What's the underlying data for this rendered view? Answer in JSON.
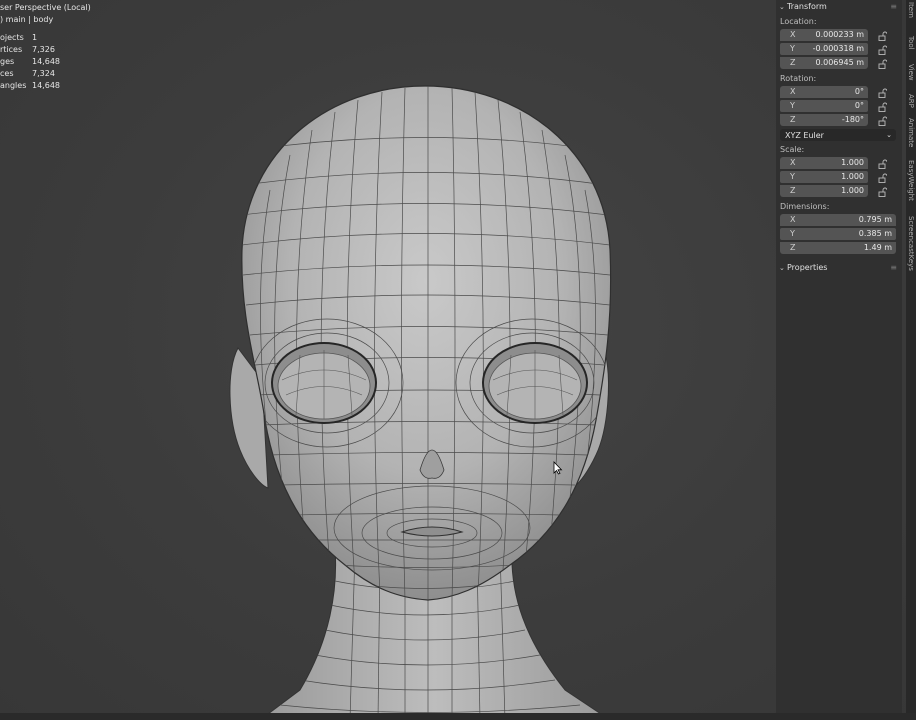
{
  "viewport": {
    "view_name": "ser Perspective (Local)",
    "collection": ") main | body",
    "stats": [
      {
        "label": "Objects",
        "shown": "ojects",
        "value": "1"
      },
      {
        "label": "Vertices",
        "shown": "rtices",
        "value": "7,326"
      },
      {
        "label": "Edges",
        "shown": "ges",
        "value": "14,648"
      },
      {
        "label": "Faces",
        "shown": "ces",
        "value": "7,324"
      },
      {
        "label": "Triangles",
        "shown": "angles",
        "value": "14,648"
      }
    ]
  },
  "panel": {
    "transform_title": "Transform",
    "location_label": "Location:",
    "location": {
      "x": "0.000233 m",
      "y": "-0.000318 m",
      "z": "0.006945 m"
    },
    "rotation_label": "Rotation:",
    "rotation": {
      "x": "0°",
      "y": "0°",
      "z": "-180°"
    },
    "rotation_mode": "XYZ Euler",
    "scale_label": "Scale:",
    "scale": {
      "x": "1.000",
      "y": "1.000",
      "z": "1.000"
    },
    "dimensions_label": "Dimensions:",
    "dimensions": {
      "x": "0.795 m",
      "y": "0.385 m",
      "z": "1.49 m"
    },
    "properties_title": "Properties",
    "axis_labels": {
      "x": "X",
      "y": "Y",
      "z": "Z"
    }
  },
  "tabs": [
    "Item",
    "Tool",
    "View",
    "ARP",
    "Animate",
    "EasyWeight",
    "ScreencastKeys"
  ],
  "colors": {
    "viewport_bg": "#3d3d3d",
    "panel_bg": "#303030",
    "field_bg": "#545454",
    "mesh": "#b9b9b9"
  }
}
